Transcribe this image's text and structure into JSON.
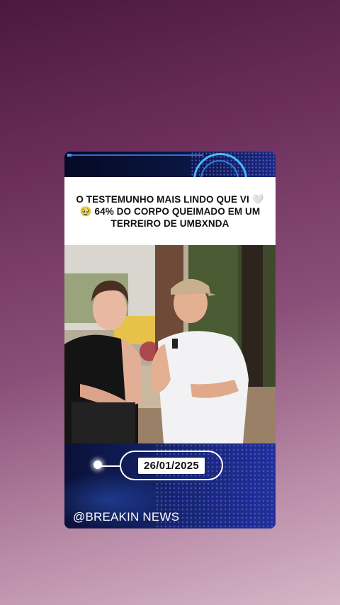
{
  "post": {
    "headline": "O TESTEMUNHO MAIS LINDO QUE VI 🤍🥹 64% DO CORPO QUEIMADO EM UM TERREIRO DE UMBXNDA",
    "date": "26/01/2025",
    "handle": "@BREAKIN NEWS"
  },
  "photo": {
    "description_icon": "video-frame-icon"
  },
  "colors": {
    "accent_blue": "#47b8ff",
    "background_top": "#4a1840",
    "background_bottom": "#d6b6c8"
  }
}
